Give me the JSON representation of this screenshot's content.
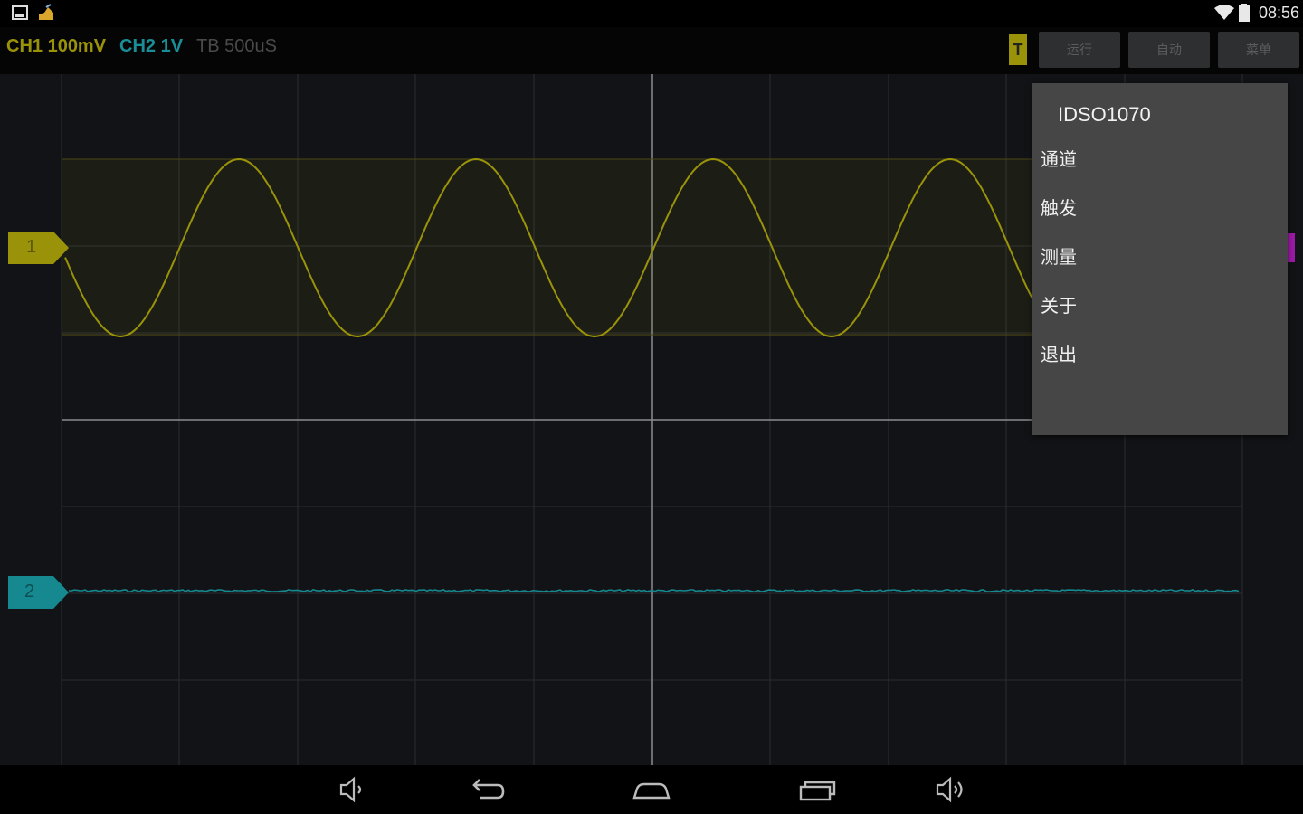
{
  "status_bar": {
    "time": "08:56",
    "icons": [
      "image-notification-icon",
      "app-notification-icon",
      "wifi-icon",
      "battery-icon"
    ]
  },
  "toolbar": {
    "ch1": {
      "label": "CH1 100mV",
      "color": "#9a930a"
    },
    "ch2": {
      "label": "CH2 1V",
      "color": "#1a8e96"
    },
    "timebase": {
      "label": "TB 500uS",
      "color": "#4a4a4a"
    },
    "trigger_label": "T",
    "buttons": [
      {
        "label": "运行"
      },
      {
        "label": "自动"
      },
      {
        "label": "菜单"
      }
    ]
  },
  "scope": {
    "grid_color": "#2a2c30",
    "ch1_marker": "1",
    "ch2_marker": "2",
    "ch1_color": "#9a930a",
    "ch2_color": "#16888f"
  },
  "menu": {
    "title": "IDSO1070",
    "items": [
      "通道",
      "触发",
      "测量",
      "关于",
      "退出"
    ]
  },
  "nav_bar": {
    "icons": [
      "volume-down-icon",
      "back-icon",
      "home-icon",
      "recents-icon",
      "volume-up-icon"
    ]
  }
}
